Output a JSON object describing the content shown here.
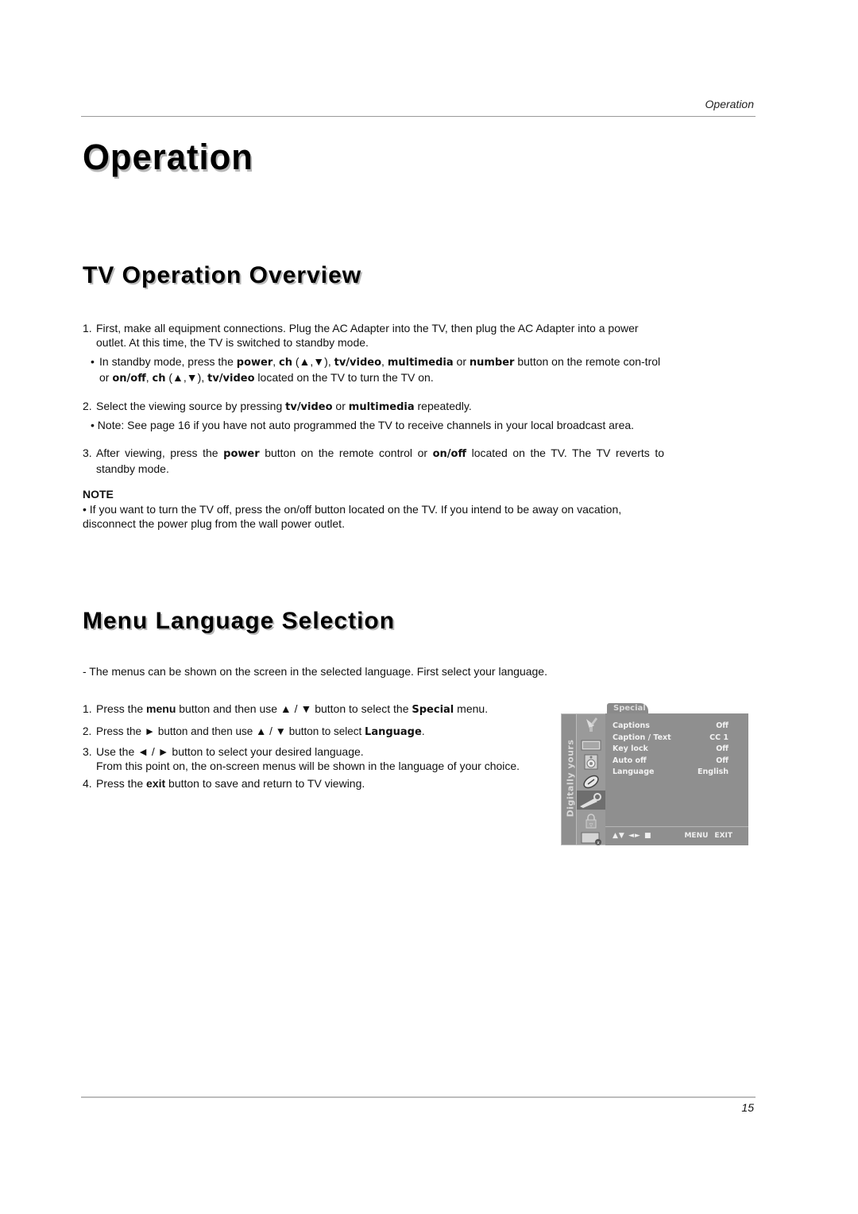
{
  "header": {
    "running_title": "Operation"
  },
  "page_title": "Operation",
  "section1": {
    "title": "TV Operation Overview",
    "step1": {
      "num": "1.",
      "text": "First, make all equipment connections. Plug the AC Adapter into the TV, then plug the AC Adapter into a power outlet. At this time, the TV is switched to standby mode.",
      "bullet": {
        "mark": "•",
        "parts": [
          {
            "t": "In standby mode, press the ",
            "b": false
          },
          {
            "t": "power",
            "b": true
          },
          {
            "t": ", ",
            "b": false
          },
          {
            "t": "ch",
            "b": true
          },
          {
            "t": " (▲,▼), ",
            "b": false
          },
          {
            "t": "tv/video",
            "b": true
          },
          {
            "t": ", ",
            "b": false
          },
          {
            "t": "multimedia",
            "b": true
          },
          {
            "t": " or ",
            "b": false
          },
          {
            "t": "number",
            "b": true
          },
          {
            "t": " button on the remote con-trol or ",
            "b": false
          },
          {
            "t": "on/off",
            "b": true
          },
          {
            "t": ", ",
            "b": false
          },
          {
            "t": "ch",
            "b": true
          },
          {
            "t": " (▲,▼), ",
            "b": false
          },
          {
            "t": "tv/video",
            "b": true
          },
          {
            "t": " located on the TV to turn the TV on.",
            "b": false
          }
        ]
      }
    },
    "step2": {
      "num": "2.",
      "parts": [
        {
          "t": "Select the viewing source by pressing ",
          "b": false
        },
        {
          "t": "tv/video",
          "b": true
        },
        {
          "t": " or ",
          "b": false
        },
        {
          "t": "multimedia",
          "b": true
        },
        {
          "t": " repeatedly.",
          "b": false
        }
      ],
      "bullet": "• Note: See page 16 if you have not auto programmed the TV to receive channels in your local broadcast area."
    },
    "step3": {
      "num": "3.",
      "parts": [
        {
          "t": "After viewing, press the ",
          "b": false
        },
        {
          "t": "power",
          "b": true
        },
        {
          "t": " button on the remote control or ",
          "b": false
        },
        {
          "t": "on/off",
          "b": true
        },
        {
          "t": " located on the TV. The TV reverts to standby mode.",
          "b": false
        }
      ]
    },
    "note_label": "NOTE",
    "note_text": "• If you want to turn the TV off, press the on/off button located on the TV. If you intend to be away on vacation, disconnect the power plug from the wall power outlet."
  },
  "section2": {
    "title": "Menu Language Selection",
    "intro": "-  The menus can be shown on the screen in the selected language. First select your language.",
    "steps": [
      {
        "num": "1.",
        "parts": [
          {
            "t": "Press the ",
            "b": false
          },
          {
            "t": "menu",
            "b": "s"
          },
          {
            "t": " button and then use ▲ / ▼ button to select the ",
            "b": false
          },
          {
            "t": "Special",
            "b": true
          },
          {
            "t": " menu.",
            "b": false
          }
        ]
      },
      {
        "num": "2.",
        "parts": [
          {
            "t": "Press the ► button and then use ▲ / ▼ button to select ",
            "b": false
          },
          {
            "t": "Language",
            "b": true
          },
          {
            "t": ".",
            "b": false
          }
        ]
      },
      {
        "num": "3.",
        "parts": [
          {
            "t": "Use the ◄ / ► button to select your desired language.",
            "b": false
          }
        ],
        "sub": "From this point on, the on-screen menus will be shown in the language of your choice."
      },
      {
        "num": "4.",
        "parts": [
          {
            "t": "Press the ",
            "b": false
          },
          {
            "t": "exit",
            "b": "s"
          },
          {
            "t": " button to save and return to TV viewing.",
            "b": false
          }
        ]
      }
    ]
  },
  "osd": {
    "brand": "Digitally yours",
    "tab": "Special",
    "icons": [
      "satellite-dish-icon",
      "picture-icon",
      "speaker-icon",
      "clock-icon",
      "special-key-icon",
      "lock-icon",
      "screen-icon"
    ],
    "active_icon": 4,
    "rows": [
      {
        "label": "Captions",
        "value": "Off"
      },
      {
        "label": "Caption / Text",
        "value": "CC 1"
      },
      {
        "label": "Key lock",
        "value": "Off"
      },
      {
        "label": "Auto off",
        "value": "Off"
      },
      {
        "label": "Language",
        "value": "English"
      }
    ],
    "nav_symbols": "▲▼ ◄► ■",
    "keys": [
      "MENU",
      "EXIT"
    ]
  },
  "footer": {
    "page_number": "15"
  }
}
